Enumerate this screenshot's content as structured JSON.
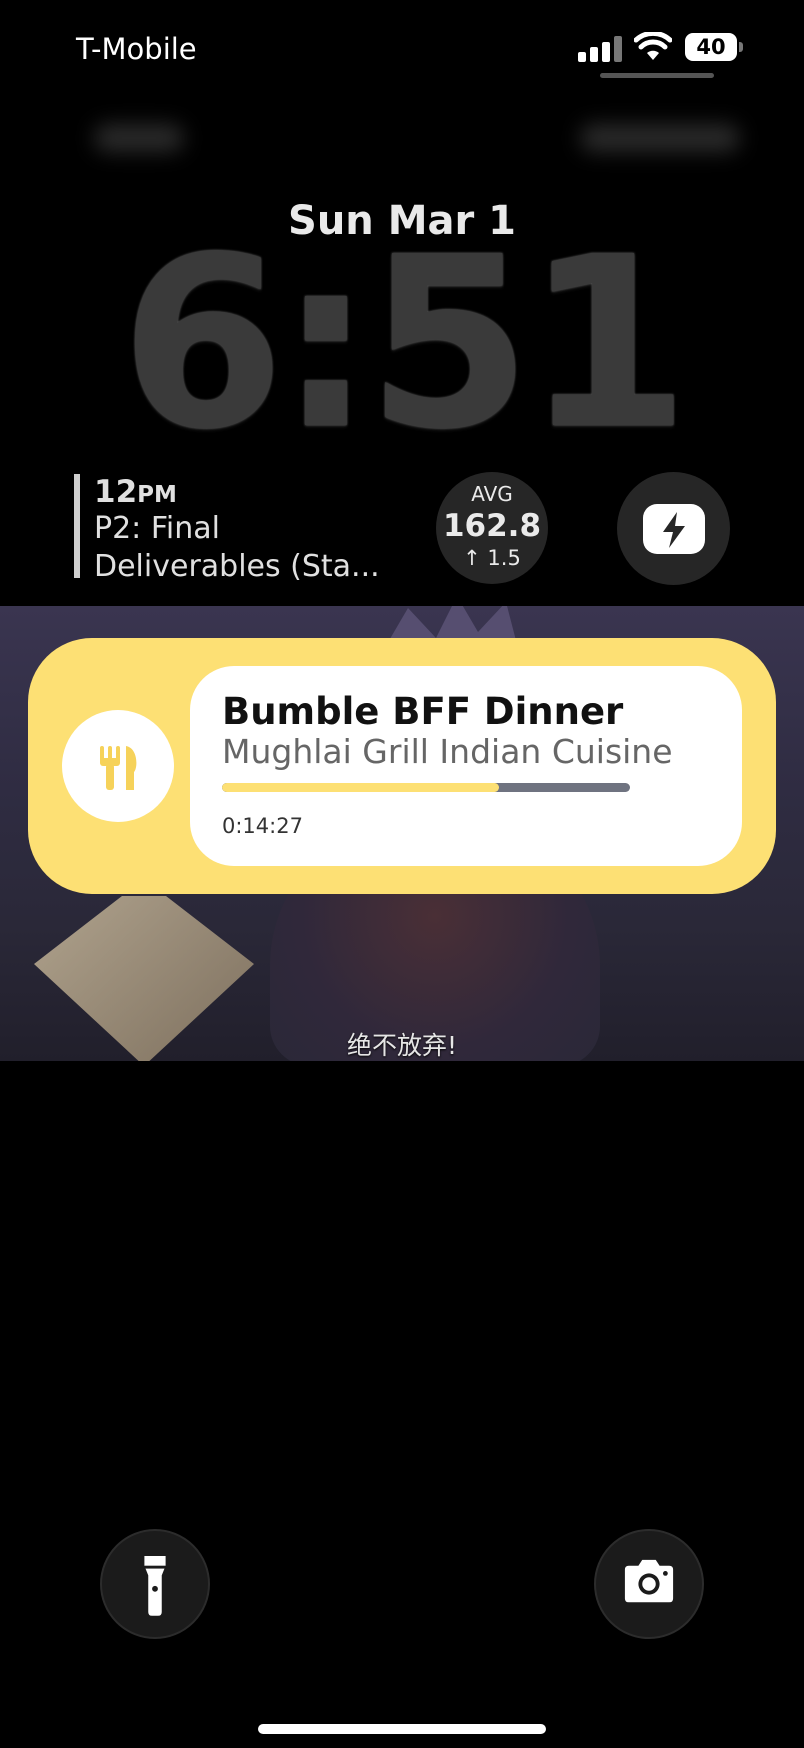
{
  "status_bar": {
    "carrier": "T-Mobile",
    "battery": "40"
  },
  "lock_screen": {
    "date": "Sun Mar 1",
    "time": "6:51"
  },
  "widgets": {
    "calendar": {
      "hour": "12",
      "meridiem": "PM",
      "line1": "P2: Final",
      "line2": "Deliverables (Sta..."
    },
    "avg": {
      "label": "AVG",
      "value": "162.8",
      "delta": "↑ 1.5"
    },
    "shortcut_icon": "bolt-camera-icon"
  },
  "live_activity": {
    "title": "Bumble BFF Dinner",
    "subtitle": "Mughlai Grill Indian Cuisine",
    "progress": 0.68,
    "elapsed": "0:14:27",
    "icon": "fork-knife-icon",
    "colors": {
      "accent": "#fde074",
      "track": "#6f7380"
    }
  },
  "media": {
    "subtitle": "绝不放弃!"
  },
  "bottom_controls": {
    "left_icon": "flashlight-icon",
    "right_icon": "camera-icon"
  }
}
